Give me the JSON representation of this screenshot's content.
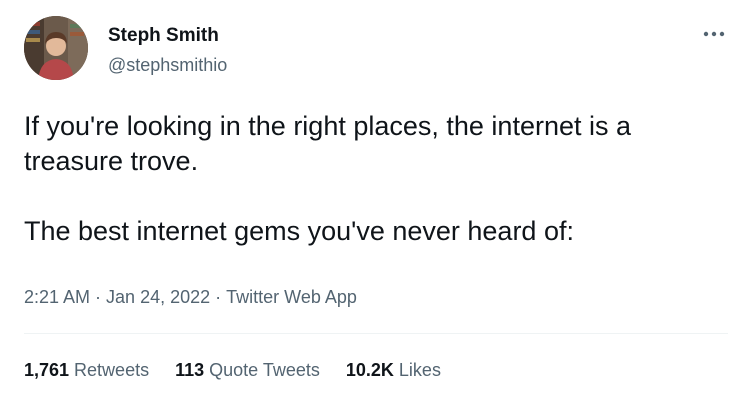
{
  "author": {
    "name": "Steph Smith",
    "handle": "@stephsmithio",
    "avatar_icon": "profile-photo"
  },
  "more_icon": "ellipsis-icon",
  "tweet": {
    "paragraphs": [
      "If you're looking in the right places, the internet is a treasure trove.",
      "The best internet gems you've never heard of:"
    ]
  },
  "meta": {
    "time": "2:21 AM",
    "separator": "·",
    "date": "Jan 24, 2022",
    "source": "Twitter Web App"
  },
  "stats": {
    "retweets": {
      "count": "1,761",
      "label": "Retweets"
    },
    "quotes": {
      "count": "113",
      "label": "Quote Tweets"
    },
    "likes": {
      "count": "10.2K",
      "label": "Likes"
    }
  },
  "colors": {
    "primary_text": "#0f1419",
    "secondary_text": "#536471",
    "divider": "#eff3f4"
  }
}
